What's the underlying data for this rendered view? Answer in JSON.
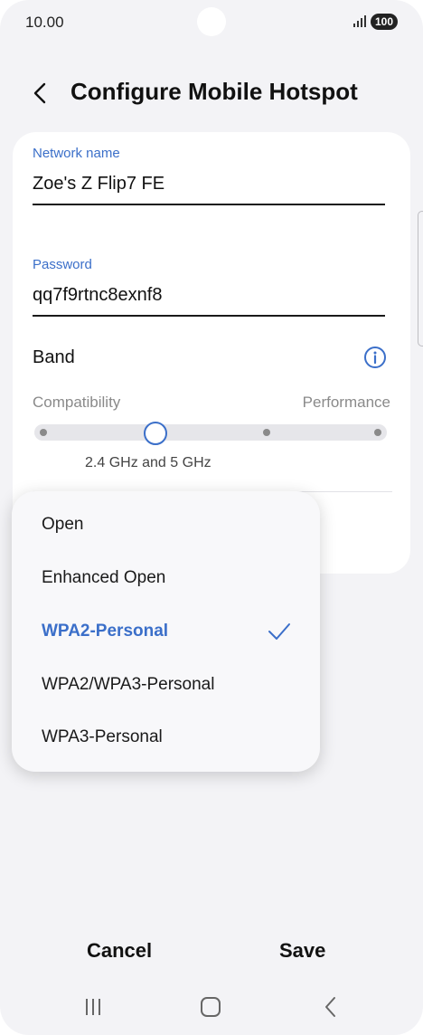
{
  "status_bar": {
    "time": "10.00",
    "battery": "100"
  },
  "header": {
    "back_icon": "chevron-left-icon",
    "title": "Configure Mobile Hotspot"
  },
  "form": {
    "network_name": {
      "label": "Network name",
      "value": "Zoe's Z Flip7 FE"
    },
    "password": {
      "label": "Password",
      "value": "qq7f9rtnc8exnf8"
    },
    "band": {
      "label": "Band",
      "info_icon": "info-icon",
      "min_label": "Compatibility",
      "max_label": "Performance",
      "selected_label": "2.4 GHz and 5 GHz",
      "slider_steps": 4,
      "selected_index": 1
    }
  },
  "security_dropdown": {
    "options": [
      {
        "label": "Open",
        "selected": false
      },
      {
        "label": "Enhanced Open",
        "selected": false
      },
      {
        "label": "WPA2-Personal",
        "selected": true
      },
      {
        "label": "WPA2/WPA3-Personal",
        "selected": false
      },
      {
        "label": "WPA3-Personal",
        "selected": false
      }
    ],
    "selected_icon": "check-icon"
  },
  "actions": {
    "cancel_label": "Cancel",
    "save_label": "Save"
  },
  "nav_bar": {
    "recents_icon": "recents-icon",
    "home_icon": "home-icon",
    "back_icon": "back-icon"
  },
  "colors": {
    "accent": "#3b6fc9",
    "background": "#f3f3f6",
    "card": "#ffffff"
  }
}
